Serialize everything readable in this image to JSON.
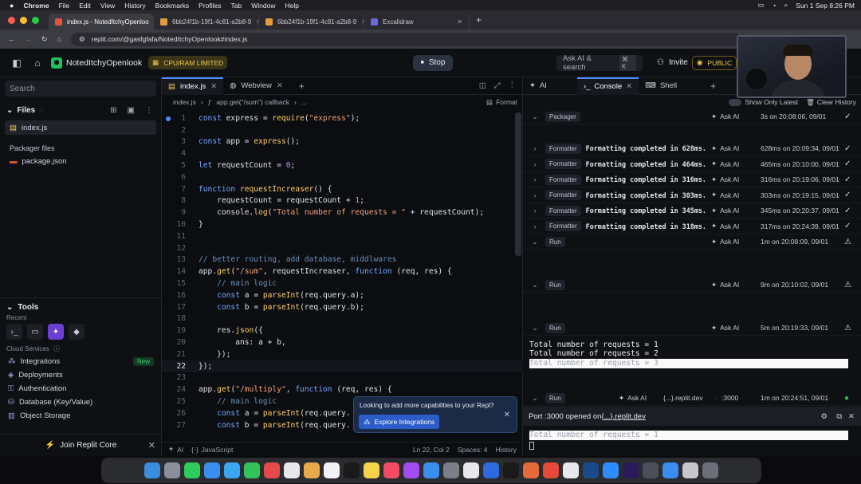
{
  "menubar": {
    "app": "Chrome",
    "items": [
      "File",
      "Edit",
      "View",
      "History",
      "Bookmarks",
      "Profiles",
      "Tab",
      "Window",
      "Help"
    ],
    "clock": "Sun 1 Sep  8:26 PM"
  },
  "browser": {
    "tabs": [
      {
        "label": "index.js - NotedItchyOpenloo",
        "active": true,
        "color": "#e5533d"
      },
      {
        "label": "6bb24f1b-19f1-4c81-a2b8-9",
        "active": false,
        "color": "#e59a3d"
      },
      {
        "label": "6bb24f1b-19f1-4c81-a2b8-9",
        "active": false,
        "color": "#e59a3d"
      },
      {
        "label": "Excalidraw",
        "active": false,
        "color": "#6a6ae0"
      }
    ],
    "url": "replit.com/@gasfgfafa/NotedItchyOpenlook#index.js"
  },
  "topbar": {
    "repl_name": "NotedItchyOpenlook",
    "cpu_badge": "CPU/RAM LIMITED",
    "stop_label": "Stop",
    "ask_ai_search": "Ask AI & search",
    "shortcut": "⌘ K",
    "invite_label": "Invite",
    "public_label": "PUBLIC"
  },
  "sidebar": {
    "search_placeholder": "Search",
    "files_heading": "Files",
    "files": [
      "index.js"
    ],
    "packager_heading": "Packager files",
    "packager_files": [
      "package.json"
    ],
    "tools_heading": "Tools",
    "recent_label": "Recent",
    "cloud_services_label": "Cloud Services",
    "services": [
      {
        "label": "Integrations",
        "badge": "New"
      },
      {
        "label": "Deployments",
        "badge": ""
      },
      {
        "label": "Authentication",
        "badge": ""
      },
      {
        "label": "Database (Key/Value)",
        "badge": ""
      },
      {
        "label": "Object Storage",
        "badge": ""
      }
    ],
    "join_label": "Join Replit Core"
  },
  "editor": {
    "tabs": [
      "index.js",
      "Webview"
    ],
    "breadcrumb_file": "index.js",
    "breadcrumb_fn": "app.get(\"/sum\") callback",
    "breadcrumb_more": "...",
    "format_label": "Format",
    "status": {
      "ai": "AI",
      "lang": "JavaScript",
      "position": "Ln 22, Col 2",
      "spaces": "Spaces: 4",
      "history": "History"
    },
    "popup": {
      "title": "Looking to add more capabilities to your Repl?",
      "button": "Explore Integrations"
    }
  },
  "code_lines": [
    {
      "n": "1",
      "parts": [
        [
          "kw",
          "const "
        ],
        [
          "tx",
          "express = "
        ],
        [
          "fn",
          "require"
        ],
        [
          "tx",
          "("
        ],
        [
          "str",
          "\"express\""
        ],
        [
          "tx",
          ");"
        ]
      ]
    },
    {
      "n": "2",
      "parts": []
    },
    {
      "n": "3",
      "parts": [
        [
          "kw",
          "const "
        ],
        [
          "tx",
          "app = "
        ],
        [
          "fn",
          "express"
        ],
        [
          "tx",
          "();"
        ]
      ]
    },
    {
      "n": "4",
      "parts": []
    },
    {
      "n": "5",
      "parts": [
        [
          "kw",
          "let "
        ],
        [
          "tx",
          "requestCount = "
        ],
        [
          "nm",
          "0"
        ],
        [
          "tx",
          ";"
        ]
      ]
    },
    {
      "n": "6",
      "parts": []
    },
    {
      "n": "7",
      "parts": [
        [
          "kw",
          "function "
        ],
        [
          "fn",
          "requestIncreaser"
        ],
        [
          "tx",
          "() {"
        ]
      ]
    },
    {
      "n": "8",
      "parts": [
        [
          "tx",
          "    requestCount = requestCount + "
        ],
        [
          "nm",
          "1"
        ],
        [
          "tx",
          ";"
        ]
      ]
    },
    {
      "n": "9",
      "parts": [
        [
          "tx",
          "    console."
        ],
        [
          "fn",
          "log"
        ],
        [
          "tx",
          "("
        ],
        [
          "str",
          "\"Total number of requests = \""
        ],
        [
          "tx",
          " + requestCount);"
        ]
      ]
    },
    {
      "n": "10",
      "parts": [
        [
          "tx",
          "}"
        ]
      ]
    },
    {
      "n": "11",
      "parts": []
    },
    {
      "n": "12",
      "parts": []
    },
    {
      "n": "13",
      "parts": [
        [
          "cm",
          "// better routing, add database, middlwares"
        ]
      ]
    },
    {
      "n": "14",
      "parts": [
        [
          "tx",
          "app."
        ],
        [
          "fn",
          "get"
        ],
        [
          "tx",
          "("
        ],
        [
          "str",
          "\"/sum\""
        ],
        [
          "tx",
          ", requestIncreaser, "
        ],
        [
          "kw",
          "function "
        ],
        [
          "tx",
          "(req, res) {"
        ]
      ]
    },
    {
      "n": "15",
      "parts": [
        [
          "cm",
          "    // main logic"
        ]
      ]
    },
    {
      "n": "16",
      "parts": [
        [
          "kw",
          "    const "
        ],
        [
          "tx",
          "a = "
        ],
        [
          "fn",
          "parseInt"
        ],
        [
          "tx",
          "(req.query.a);"
        ]
      ]
    },
    {
      "n": "17",
      "parts": [
        [
          "kw",
          "    const "
        ],
        [
          "tx",
          "b = "
        ],
        [
          "fn",
          "parseInt"
        ],
        [
          "tx",
          "(req.query.b);"
        ]
      ]
    },
    {
      "n": "18",
      "parts": []
    },
    {
      "n": "19",
      "parts": [
        [
          "tx",
          "    res."
        ],
        [
          "fn",
          "json"
        ],
        [
          "tx",
          "({"
        ]
      ]
    },
    {
      "n": "20",
      "parts": [
        [
          "tx",
          "        ans: a + b,"
        ]
      ]
    },
    {
      "n": "21",
      "parts": [
        [
          "tx",
          "    });"
        ]
      ]
    },
    {
      "n": "22",
      "parts": [
        [
          "tx",
          "});"
        ]
      ]
    },
    {
      "n": "23",
      "parts": []
    },
    {
      "n": "24",
      "parts": [
        [
          "tx",
          "app."
        ],
        [
          "fn",
          "get"
        ],
        [
          "tx",
          "("
        ],
        [
          "str",
          "\"/multiply\""
        ],
        [
          "tx",
          ", "
        ],
        [
          "kw",
          "function "
        ],
        [
          "tx",
          "(req, res) {"
        ]
      ]
    },
    {
      "n": "25",
      "parts": [
        [
          "cm",
          "    // main logic"
        ]
      ]
    },
    {
      "n": "26",
      "parts": [
        [
          "kw",
          "    const "
        ],
        [
          "tx",
          "a = "
        ],
        [
          "fn",
          "parseInt"
        ],
        [
          "tx",
          "(req.query."
        ]
      ]
    },
    {
      "n": "27",
      "parts": [
        [
          "kw",
          "    const "
        ],
        [
          "tx",
          "b = "
        ],
        [
          "fn",
          "parseInt"
        ],
        [
          "tx",
          "(req.query."
        ]
      ]
    }
  ],
  "console": {
    "tabs": [
      "AI",
      "Console",
      "Shell"
    ],
    "show_only_latest": "Show Only Latest",
    "clear_history": "Clear History",
    "ask_ai": "Ask AI",
    "entries": [
      {
        "tag": "Packager",
        "msg": "",
        "time": "3s on 20:08:06, 09/01",
        "status": "check"
      },
      {
        "tag": "Formatter",
        "msg": "Formatting completed in 628ms.",
        "time": "628ms on 20:09:34, 09/01",
        "status": "check"
      },
      {
        "tag": "Formatter",
        "msg": "Formatting completed in 464ms.",
        "time": "465ms on 20:10:00, 09/01",
        "status": "check"
      },
      {
        "tag": "Formatter",
        "msg": "Formatting completed in 316ms.",
        "time": "316ms on 20:19:06, 09/01",
        "status": "check"
      },
      {
        "tag": "Formatter",
        "msg": "Formatting completed in 303ms.",
        "time": "303ms on 20:19:15, 09/01",
        "status": "check"
      },
      {
        "tag": "Formatter",
        "msg": "Formatting completed in 345ms.",
        "time": "345ms on 20:20:37, 09/01",
        "status": "check"
      },
      {
        "tag": "Formatter",
        "msg": "Formatting completed in 318ms.",
        "time": "317ms on 20:24:39, 09/01",
        "status": "check"
      },
      {
        "tag": "Run",
        "msg": "",
        "time": "1m on 20:08:09, 09/01",
        "status": "warn"
      },
      {
        "tag": "Run",
        "msg": "",
        "time": "9m on 20:10:02, 09/01",
        "status": "warn"
      },
      {
        "tag": "Run",
        "msg": "",
        "time": "5m on 20:19:33, 09/01",
        "status": "warn"
      }
    ],
    "outputs": [
      "Total number of requests = 1",
      "Total number of requests = 2",
      "Total number of requests = 3"
    ],
    "last_run": {
      "tag": "Run",
      "link": "{...}.replit.dev",
      "port": ":3000",
      "time": "1m on 20:24:51, 09/01"
    },
    "port_message": "Port :3000 opened on ",
    "port_link": "{...}.replit.dev",
    "final_output": "Total number of requests = 1"
  },
  "colors": {
    "accent": "#4c8dff",
    "success": "#20c05c",
    "warn": "#d9dbe2"
  }
}
